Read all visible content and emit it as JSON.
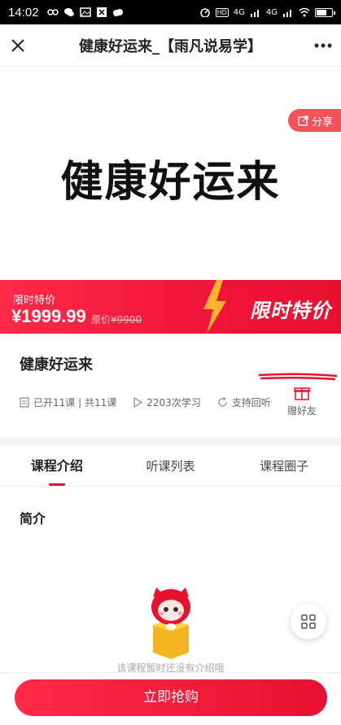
{
  "status_bar": {
    "time": "14:02",
    "network_1": "4G",
    "network_2": "4G"
  },
  "header": {
    "title": "健康好运来_【雨凡说易学】",
    "close_icon": "close-icon",
    "more_icon": "more-icon"
  },
  "banner": {
    "calligraphy_text": "健康好运来",
    "share_label": "分享"
  },
  "promo": {
    "label": "限时特价",
    "price": "¥1999.99",
    "original_prefix": "原价",
    "original_price": "¥9900",
    "badge_text": "限时特价"
  },
  "course": {
    "title": "健康好运来",
    "progress": "已开11课 | 共11课",
    "learners": "2203次学习",
    "replay": "支持回听",
    "gift_label": "赠好友"
  },
  "tabs": [
    {
      "label": "课程介绍",
      "active": true
    },
    {
      "label": "听课列表",
      "active": false
    },
    {
      "label": "课程圈子",
      "active": false
    }
  ],
  "content": {
    "section_title": "简介",
    "empty_text": "该课程暂时还没有介绍哦"
  },
  "footer": {
    "buy_label": "立即抢购"
  },
  "colors": {
    "accent": "#e8102f",
    "share_bg": "#f5535a"
  }
}
